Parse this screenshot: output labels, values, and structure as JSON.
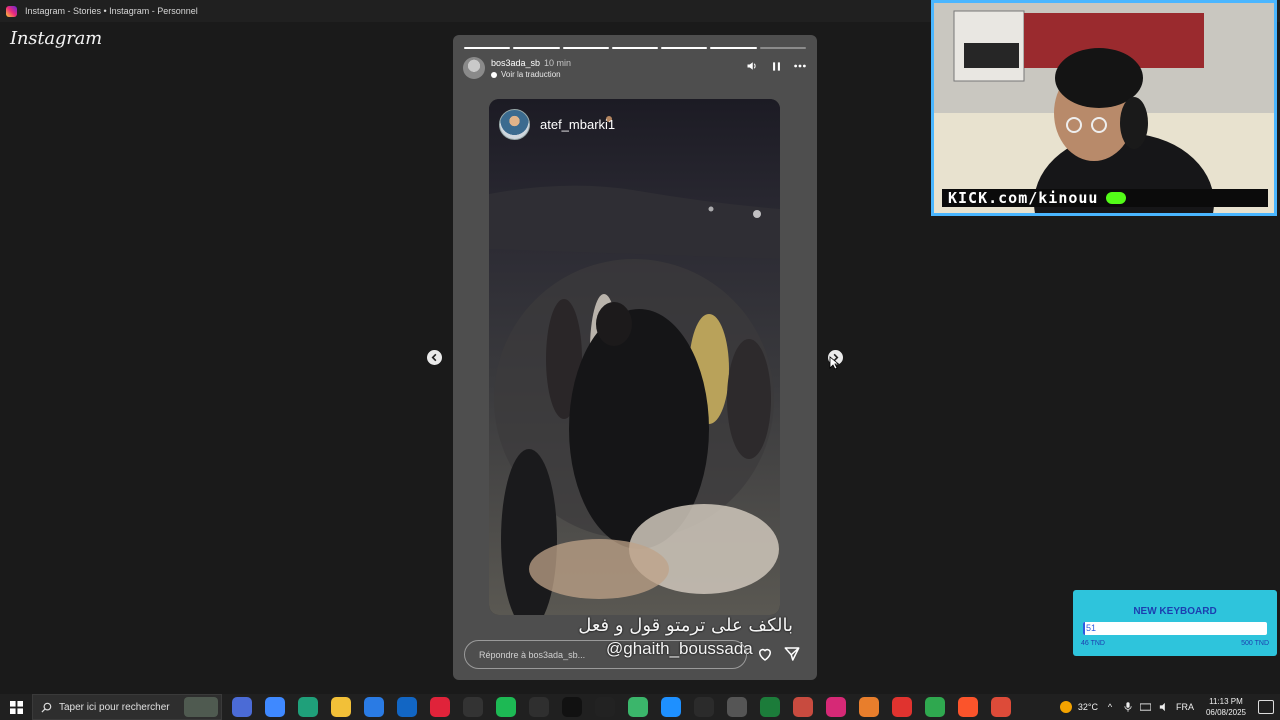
{
  "window": {
    "title": "Instagram - Stories • Instagram - Personnel",
    "favicon": "instagram-icon"
  },
  "sidebar": {
    "logo_text": "Instagram"
  },
  "story": {
    "username": "bos3ada_sb",
    "time_ago": "10 min",
    "translate_link": "Voir la traduction",
    "segments_total": 7,
    "segments_viewed": 6,
    "controls": [
      "volume-icon",
      "pause-icon",
      "more-icon"
    ],
    "shared_post": {
      "username": "atef_mbarki1"
    },
    "caption_arabic": "بالكف على ترمتو قول و فعل",
    "mention": "@ghaith_boussada",
    "reply_placeholder": "Répondre à bos3ada_sb...",
    "actions": [
      "heart-icon",
      "send-icon"
    ]
  },
  "navigation": {
    "prev": "chevron-left-icon",
    "next": "chevron-right-icon"
  },
  "webcam": {
    "banner_text": "KICK.com/kinouu"
  },
  "goal_widget": {
    "title": "NEW KEYBOARD",
    "current_value": "51",
    "min_label": "46 TND",
    "max_label": "500 TND",
    "progress_fraction": 0.01
  },
  "taskbar": {
    "search_placeholder": "Taper ici pour rechercher",
    "temperature": "32°C",
    "language": "FRA",
    "time": "11:13 PM",
    "date": "06/08/2025",
    "apps": [
      {
        "name": "copilot-icon",
        "color": "#4b6bd6"
      },
      {
        "name": "photos-icon",
        "color": "#3f89ff"
      },
      {
        "name": "edge-icon",
        "color": "#1fa07a"
      },
      {
        "name": "file-explorer-icon",
        "color": "#f2c038"
      },
      {
        "name": "store-icon",
        "color": "#2a7be4"
      },
      {
        "name": "outlook-icon",
        "color": "#1266c4"
      },
      {
        "name": "opera-icon",
        "color": "#e0233a"
      },
      {
        "name": "app-icon",
        "color": "#333333"
      },
      {
        "name": "spotify-icon",
        "color": "#1db954"
      },
      {
        "name": "app-icon-2",
        "color": "#2f2f2f"
      },
      {
        "name": "tiktok-icon",
        "color": "#111111"
      },
      {
        "name": "capcut-icon",
        "color": "#222222"
      },
      {
        "name": "app-icon-3",
        "color": "#3bb66b"
      },
      {
        "name": "vscode-icon",
        "color": "#1e90ff"
      },
      {
        "name": "obs-icon",
        "color": "#2b2b2b"
      },
      {
        "name": "settings-icon",
        "color": "#555555"
      },
      {
        "name": "terminal-icon",
        "color": "#1c7c3a"
      },
      {
        "name": "app-icon-4",
        "color": "#c84b3f"
      },
      {
        "name": "instagram-icon",
        "color": "#d62976"
      },
      {
        "name": "app-icon-5",
        "color": "#e87e2c"
      },
      {
        "name": "app-icon-6",
        "color": "#e0332f"
      },
      {
        "name": "app-icon-7",
        "color": "#2fa84f"
      },
      {
        "name": "brave-icon",
        "color": "#fb542b"
      },
      {
        "name": "chrome-icon",
        "color": "#dd4b39"
      }
    ]
  },
  "colors": {
    "background": "#1a1a1a",
    "story_bg": "#4e4e4e",
    "webcam_border": "#4ab6ff",
    "kick_green": "#53fc18",
    "goal_bg": "#2ec4dc",
    "goal_text": "#1c3fb0"
  }
}
